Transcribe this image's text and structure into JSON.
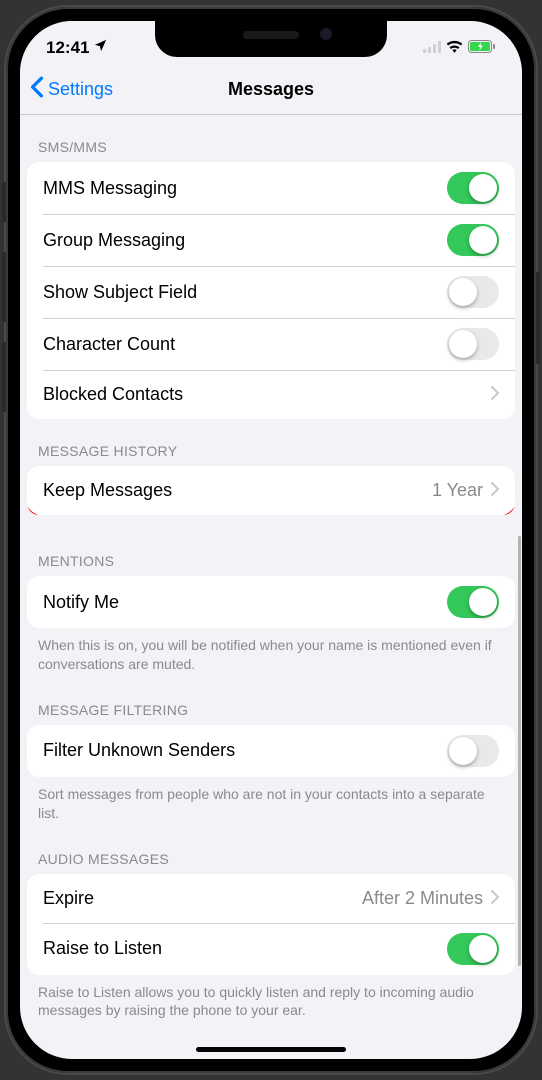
{
  "status": {
    "time": "12:41",
    "location_icon": "location-icon"
  },
  "nav": {
    "back": "Settings",
    "title": "Messages"
  },
  "sections": {
    "sms": {
      "header": "SMS/MMS",
      "mms": {
        "label": "MMS Messaging",
        "on": true
      },
      "group": {
        "label": "Group Messaging",
        "on": true
      },
      "subject": {
        "label": "Show Subject Field",
        "on": false
      },
      "char": {
        "label": "Character Count",
        "on": false
      },
      "blocked": {
        "label": "Blocked Contacts"
      }
    },
    "history": {
      "header": "MESSAGE HISTORY",
      "keep": {
        "label": "Keep Messages",
        "value": "1 Year"
      }
    },
    "mentions": {
      "header": "MENTIONS",
      "notify": {
        "label": "Notify Me",
        "on": true
      },
      "footer": "When this is on, you will be notified when your name is mentioned even if conversations are muted."
    },
    "filtering": {
      "header": "MESSAGE FILTERING",
      "filter": {
        "label": "Filter Unknown Senders",
        "on": false
      },
      "footer": "Sort messages from people who are not in your contacts into a separate list."
    },
    "audio": {
      "header": "AUDIO MESSAGES",
      "expire": {
        "label": "Expire",
        "value": "After 2 Minutes"
      },
      "raise": {
        "label": "Raise to Listen",
        "on": true
      },
      "footer": "Raise to Listen allows you to quickly listen and reply to incoming audio messages by raising the phone to your ear."
    }
  }
}
